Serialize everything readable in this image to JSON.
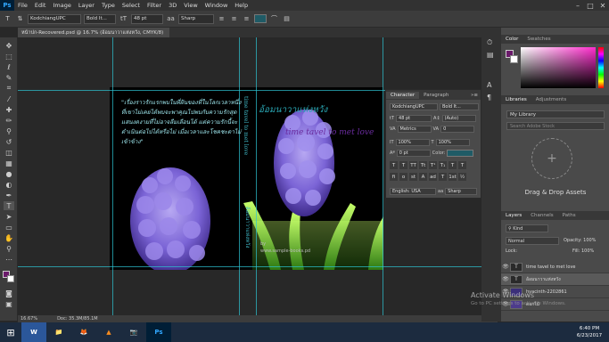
{
  "app": {
    "logo": "Ps",
    "menu": [
      "File",
      "Edit",
      "Image",
      "Layer",
      "Type",
      "Select",
      "Filter",
      "3D",
      "View",
      "Window",
      "Help"
    ],
    "window_controls": [
      "–",
      "□",
      "✕"
    ]
  },
  "options_bar": {
    "font_family": "KodchiangUPC",
    "font_style": "Bold It...",
    "font_size": "48 pt",
    "anti_alias": "Sharp",
    "text_color": "#1f5b66"
  },
  "document": {
    "tab_title": "หน้าปก-Recovered.psd @ 16.7% (อ้อมนาวาแห่งหวัง, CMYK/8)",
    "zoom": "16.67%",
    "doc_size": "Doc: 35.3M/85.1M"
  },
  "canvas": {
    "thai_paragraph": "\"เรื่องราวรักแรกพบในที่ฝันของที่ในโลกเวลาหนึ่ง ที่เขาไม่เคยได้พบจะพาคุณไปพบกับความรักสุดแสนงดงามที่ไม่อาจลืมเลือนได้ แต่ความรักนี้จะดำเนินต่อไปได้หรือไม่ เมื่อเวลาและโชคชะตาไม่เข้าข้าง\"",
    "spine_top": "time tavel to met love",
    "spine_bottom": "อ้อมนาวาแห่งหวัง",
    "cover_title": "อ้อมนาวาแห่งหวัง",
    "cover_subtitle": "time tavel to met love",
    "small_note": "by\nwww.sample-books.pd"
  },
  "character_panel": {
    "tabs": [
      "Character",
      "Paragraph"
    ],
    "font_family": "KodchiangUPC",
    "font_style": "Bold It...",
    "size": "48 pt",
    "leading": "(Auto)",
    "tracking": "0",
    "kerning": "Metrics",
    "vscale": "100%",
    "hscale": "100%",
    "baseline": "0 pt",
    "color_label": "Color:",
    "language": "English: USA",
    "aa": "Sharp",
    "style_buttons": [
      "T",
      "T",
      "TT",
      "Tt",
      "T¹",
      "T₁",
      "T",
      "T"
    ],
    "ot_buttons": [
      "fi",
      "ο",
      "st",
      "A",
      "ad",
      "T",
      "1st",
      "½"
    ]
  },
  "right_panels": {
    "color_tabs": [
      "Color",
      "Swatches"
    ],
    "fg_color": "#6a1a6a",
    "libraries_tabs": [
      "Libraries",
      "Adjustments"
    ],
    "library_name": "My Library",
    "library_search": "Search Adobe Stock",
    "drop_label": "Drag & Drop Assets",
    "layers_tabs": [
      "Layers",
      "Channels",
      "Paths"
    ],
    "kind_label": "Kind",
    "blend_mode": "Normal",
    "opacity": "Opacity: 100%",
    "lock_label": "Lock:",
    "fill": "Fill: 100%",
    "layers": [
      {
        "name": "time tavel to met love",
        "type": "T"
      },
      {
        "name": "อ้อมนาวาแห่งหวัง",
        "type": "T"
      },
      {
        "name": "hyacinth-2202861",
        "type": "img"
      },
      {
        "name": "ดอกไม้",
        "type": "img"
      }
    ]
  },
  "watermark": {
    "line1": "Activate Windows",
    "line2": "Go to PC settings to activate Windows."
  },
  "taskbar": {
    "apps": [
      "W",
      "📁",
      "🦊",
      "▲",
      "📷",
      "Ps"
    ],
    "time": "6:40 PM",
    "date": "6/23/2017"
  }
}
